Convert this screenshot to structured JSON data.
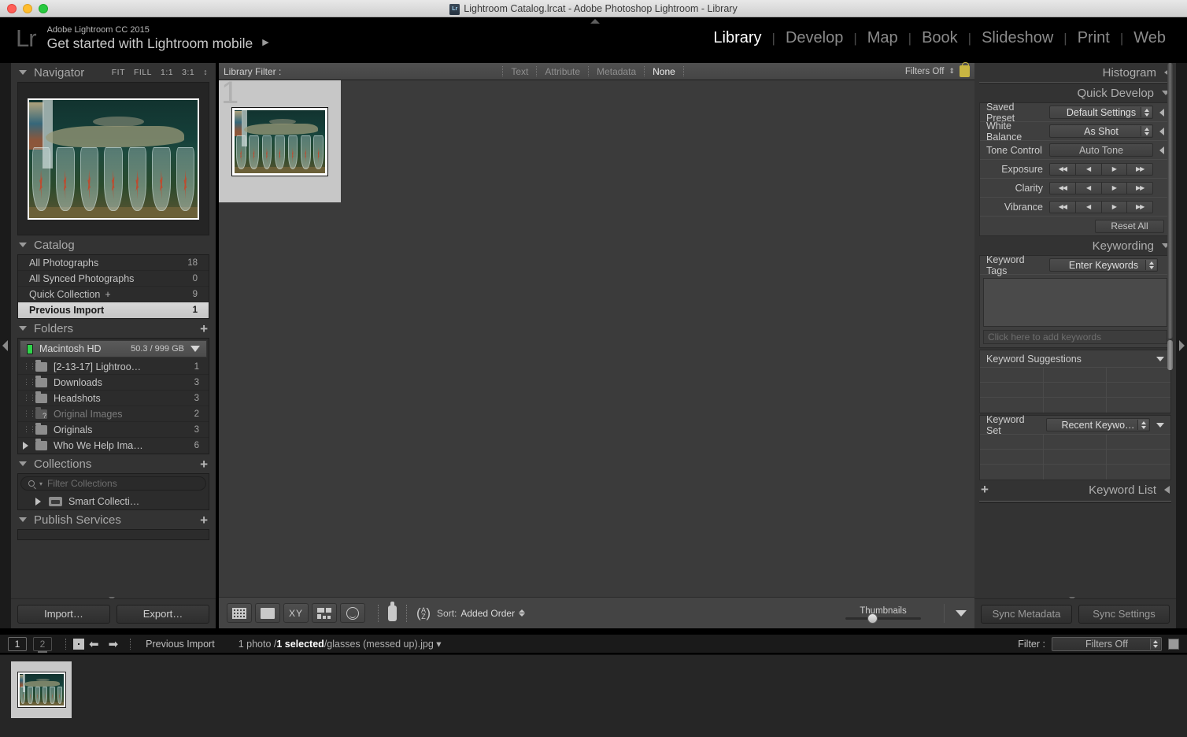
{
  "window": {
    "title": "Lightroom Catalog.lrcat - Adobe Photoshop Lightroom - Library",
    "icon": "lightroom-catalog-icon"
  },
  "identity": {
    "logo": "Lr",
    "product": "Adobe Lightroom CC 2015",
    "headline": "Get started with Lightroom mobile",
    "arrow": "▶"
  },
  "modules": {
    "items": [
      {
        "label": "Library",
        "active": true
      },
      {
        "label": "Develop",
        "active": false
      },
      {
        "label": "Map",
        "active": false
      },
      {
        "label": "Book",
        "active": false
      },
      {
        "label": "Slideshow",
        "active": false
      },
      {
        "label": "Print",
        "active": false
      },
      {
        "label": "Web",
        "active": false
      }
    ],
    "separator": "|"
  },
  "navigator": {
    "title": "Navigator",
    "zoom_levels": [
      "FIT",
      "FILL",
      "1:1",
      "3:1"
    ],
    "stepper": "↕"
  },
  "catalog": {
    "title": "Catalog",
    "items": [
      {
        "label": "All Photographs",
        "count": "18",
        "selected": false
      },
      {
        "label": "All Synced Photographs",
        "count": "0",
        "selected": false
      },
      {
        "label": "Quick Collection",
        "count": "9",
        "selected": false,
        "plus": "+"
      },
      {
        "label": "Previous Import",
        "count": "1",
        "selected": true
      }
    ]
  },
  "folders": {
    "title": "Folders",
    "add": "+",
    "volume": {
      "name": "Macintosh HD",
      "space": "50.3 / 999 GB"
    },
    "items": [
      {
        "label": "[2-13-17] Lightroo…",
        "count": "1",
        "missing": false,
        "expandable": false
      },
      {
        "label": "Downloads",
        "count": "3",
        "missing": false,
        "expandable": false
      },
      {
        "label": "Headshots",
        "count": "3",
        "missing": false,
        "expandable": false
      },
      {
        "label": "Original Images",
        "count": "2",
        "missing": true,
        "expandable": false
      },
      {
        "label": "Originals",
        "count": "3",
        "missing": false,
        "expandable": false
      },
      {
        "label": "Who We Help Ima…",
        "count": "6",
        "missing": false,
        "expandable": true
      }
    ]
  },
  "collections": {
    "title": "Collections",
    "add": "+",
    "filter_placeholder": "Filter Collections",
    "items": [
      {
        "label": "Smart Collecti…"
      }
    ]
  },
  "publish_services": {
    "title": "Publish Services",
    "add": "+"
  },
  "left_bottom": {
    "import_label": "Import…",
    "export_label": "Export…"
  },
  "library_filter": {
    "label": "Library Filter :",
    "options": [
      {
        "label": "Text",
        "active": false
      },
      {
        "label": "Attribute",
        "active": false
      },
      {
        "label": "Metadata",
        "active": false
      },
      {
        "label": "None",
        "active": true
      }
    ],
    "filters_state": "Filters Off",
    "lock": "lock-icon"
  },
  "grid": {
    "cells": [
      {
        "index": "1",
        "filename": "glasses (messed up).jpg",
        "selected": true
      }
    ]
  },
  "toolbar": {
    "view_buttons": [
      {
        "name": "grid-view",
        "label": "grid-icon"
      },
      {
        "name": "loupe-view",
        "label": "loupe-icon"
      },
      {
        "name": "compare-view",
        "label": "XY"
      },
      {
        "name": "survey-view",
        "label": "survey-icon"
      },
      {
        "name": "people-view",
        "label": "face-icon"
      }
    ],
    "painter": "spray-can-icon",
    "sort_icon": "az-sort-icon",
    "sort_label": "Sort:",
    "sort_value": "Added Order",
    "thumbnails_label": "Thumbnails",
    "thumbnail_size_percent": 30
  },
  "right": {
    "histogram": {
      "title": "Histogram"
    },
    "quick_develop": {
      "title": "Quick Develop",
      "rows": [
        {
          "label": "Saved Preset",
          "value": "Default Settings",
          "type": "popup"
        },
        {
          "label": "White Balance",
          "value": "As Shot",
          "type": "popup"
        },
        {
          "label": "Tone Control",
          "value": "Auto Tone",
          "type": "button"
        }
      ],
      "nudges": [
        {
          "label": "Exposure"
        },
        {
          "label": "Clarity"
        },
        {
          "label": "Vibrance"
        }
      ],
      "nudge_glyphs": [
        "◀◀",
        "◀",
        "▶",
        "▶▶"
      ],
      "reset_label": "Reset All"
    },
    "keywording": {
      "title": "Keywording",
      "tags_label": "Keyword Tags",
      "tags_value": "Enter Keywords",
      "add_placeholder": "Click here to add keywords",
      "suggestions_title": "Keyword Suggestions",
      "set_label": "Keyword Set",
      "set_value": "Recent Keywo…"
    },
    "keyword_list": {
      "title": "Keyword List",
      "add": "+"
    },
    "bottom": {
      "sync_metadata": "Sync Metadata",
      "sync_settings": "Sync Settings"
    }
  },
  "filmstrip_bar": {
    "screen1": "1",
    "screen2": "2",
    "grid_icon": "grid-icon",
    "back_arrow": "⬅",
    "forward_arrow": "➡",
    "source": "Previous Import",
    "photo_count": "1 photo /",
    "selected_text": "1 selected",
    "filename": "/glasses (messed up).jpg",
    "dropdown_caret": "▾",
    "filter_label": "Filter :",
    "filter_value": "Filters Off"
  },
  "colors": {
    "panel_bg": "#333333",
    "center_bg": "#3b3b3b",
    "selection": "#d8d8d8",
    "accent_text": "#ffffff",
    "led_green": "#2fd44a",
    "lock_yellow": "#c9b642"
  }
}
